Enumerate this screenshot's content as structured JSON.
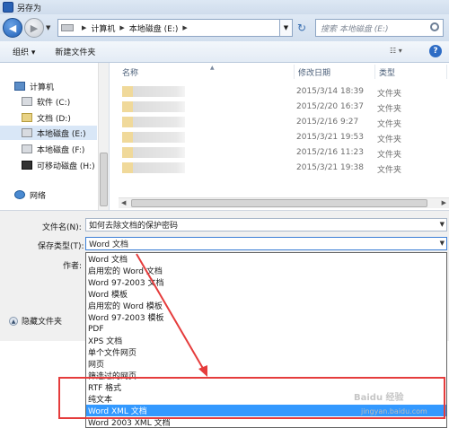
{
  "window": {
    "title": "另存为"
  },
  "address": {
    "crumbs": [
      "计算机",
      "本地磁盘 (E:)"
    ],
    "search_placeholder": "搜索 本地磁盘 (E:)"
  },
  "toolbar": {
    "organize": "组织 ▾",
    "new_folder": "新建文件夹",
    "view": "☷ ▾",
    "help": "?"
  },
  "nav": {
    "items": [
      "计算机",
      "软件 (C:)",
      "文档 (D:)",
      "本地磁盘 (E:)",
      "本地磁盘 (F:)",
      "可移动磁盘 (H:)",
      "网络"
    ]
  },
  "filelist": {
    "headers": {
      "name": "名称",
      "date": "修改日期",
      "type": "类型"
    },
    "rows": [
      {
        "date": "2015/3/14 18:39",
        "type": "文件夹"
      },
      {
        "date": "2015/2/20 16:37",
        "type": "文件夹"
      },
      {
        "date": "2015/2/16 9:27",
        "type": "文件夹"
      },
      {
        "date": "2015/3/21 19:53",
        "type": "文件夹"
      },
      {
        "date": "2015/2/16 11:23",
        "type": "文件夹"
      },
      {
        "date": "2015/3/21 19:38",
        "type": "文件夹"
      }
    ]
  },
  "form": {
    "filename_label": "文件名(N):",
    "filename_value": "如何去除文档的保护密码",
    "savetype_label": "保存类型(T):",
    "savetype_value": "Word 文档",
    "author_label": "作者:",
    "hide_folders": "隐藏文件夹"
  },
  "savetype_options": [
    "Word 文档",
    "启用宏的 Word 文档",
    "Word 97-2003 文档",
    "Word 模板",
    "启用宏的 Word 模板",
    "Word 97-2003 模板",
    "PDF",
    "XPS 文档",
    "单个文件网页",
    "网页",
    "筛选过的网页",
    "RTF 格式",
    "纯文本",
    "Word XML 文档",
    "Word 2003 XML 文档"
  ],
  "selected_option_index": 13,
  "watermark": {
    "line1": "Baidu 经验",
    "line2": "jingyan.baidu.com"
  },
  "colors": {
    "annotation": "#e53c3c",
    "selection": "#3399ff"
  }
}
